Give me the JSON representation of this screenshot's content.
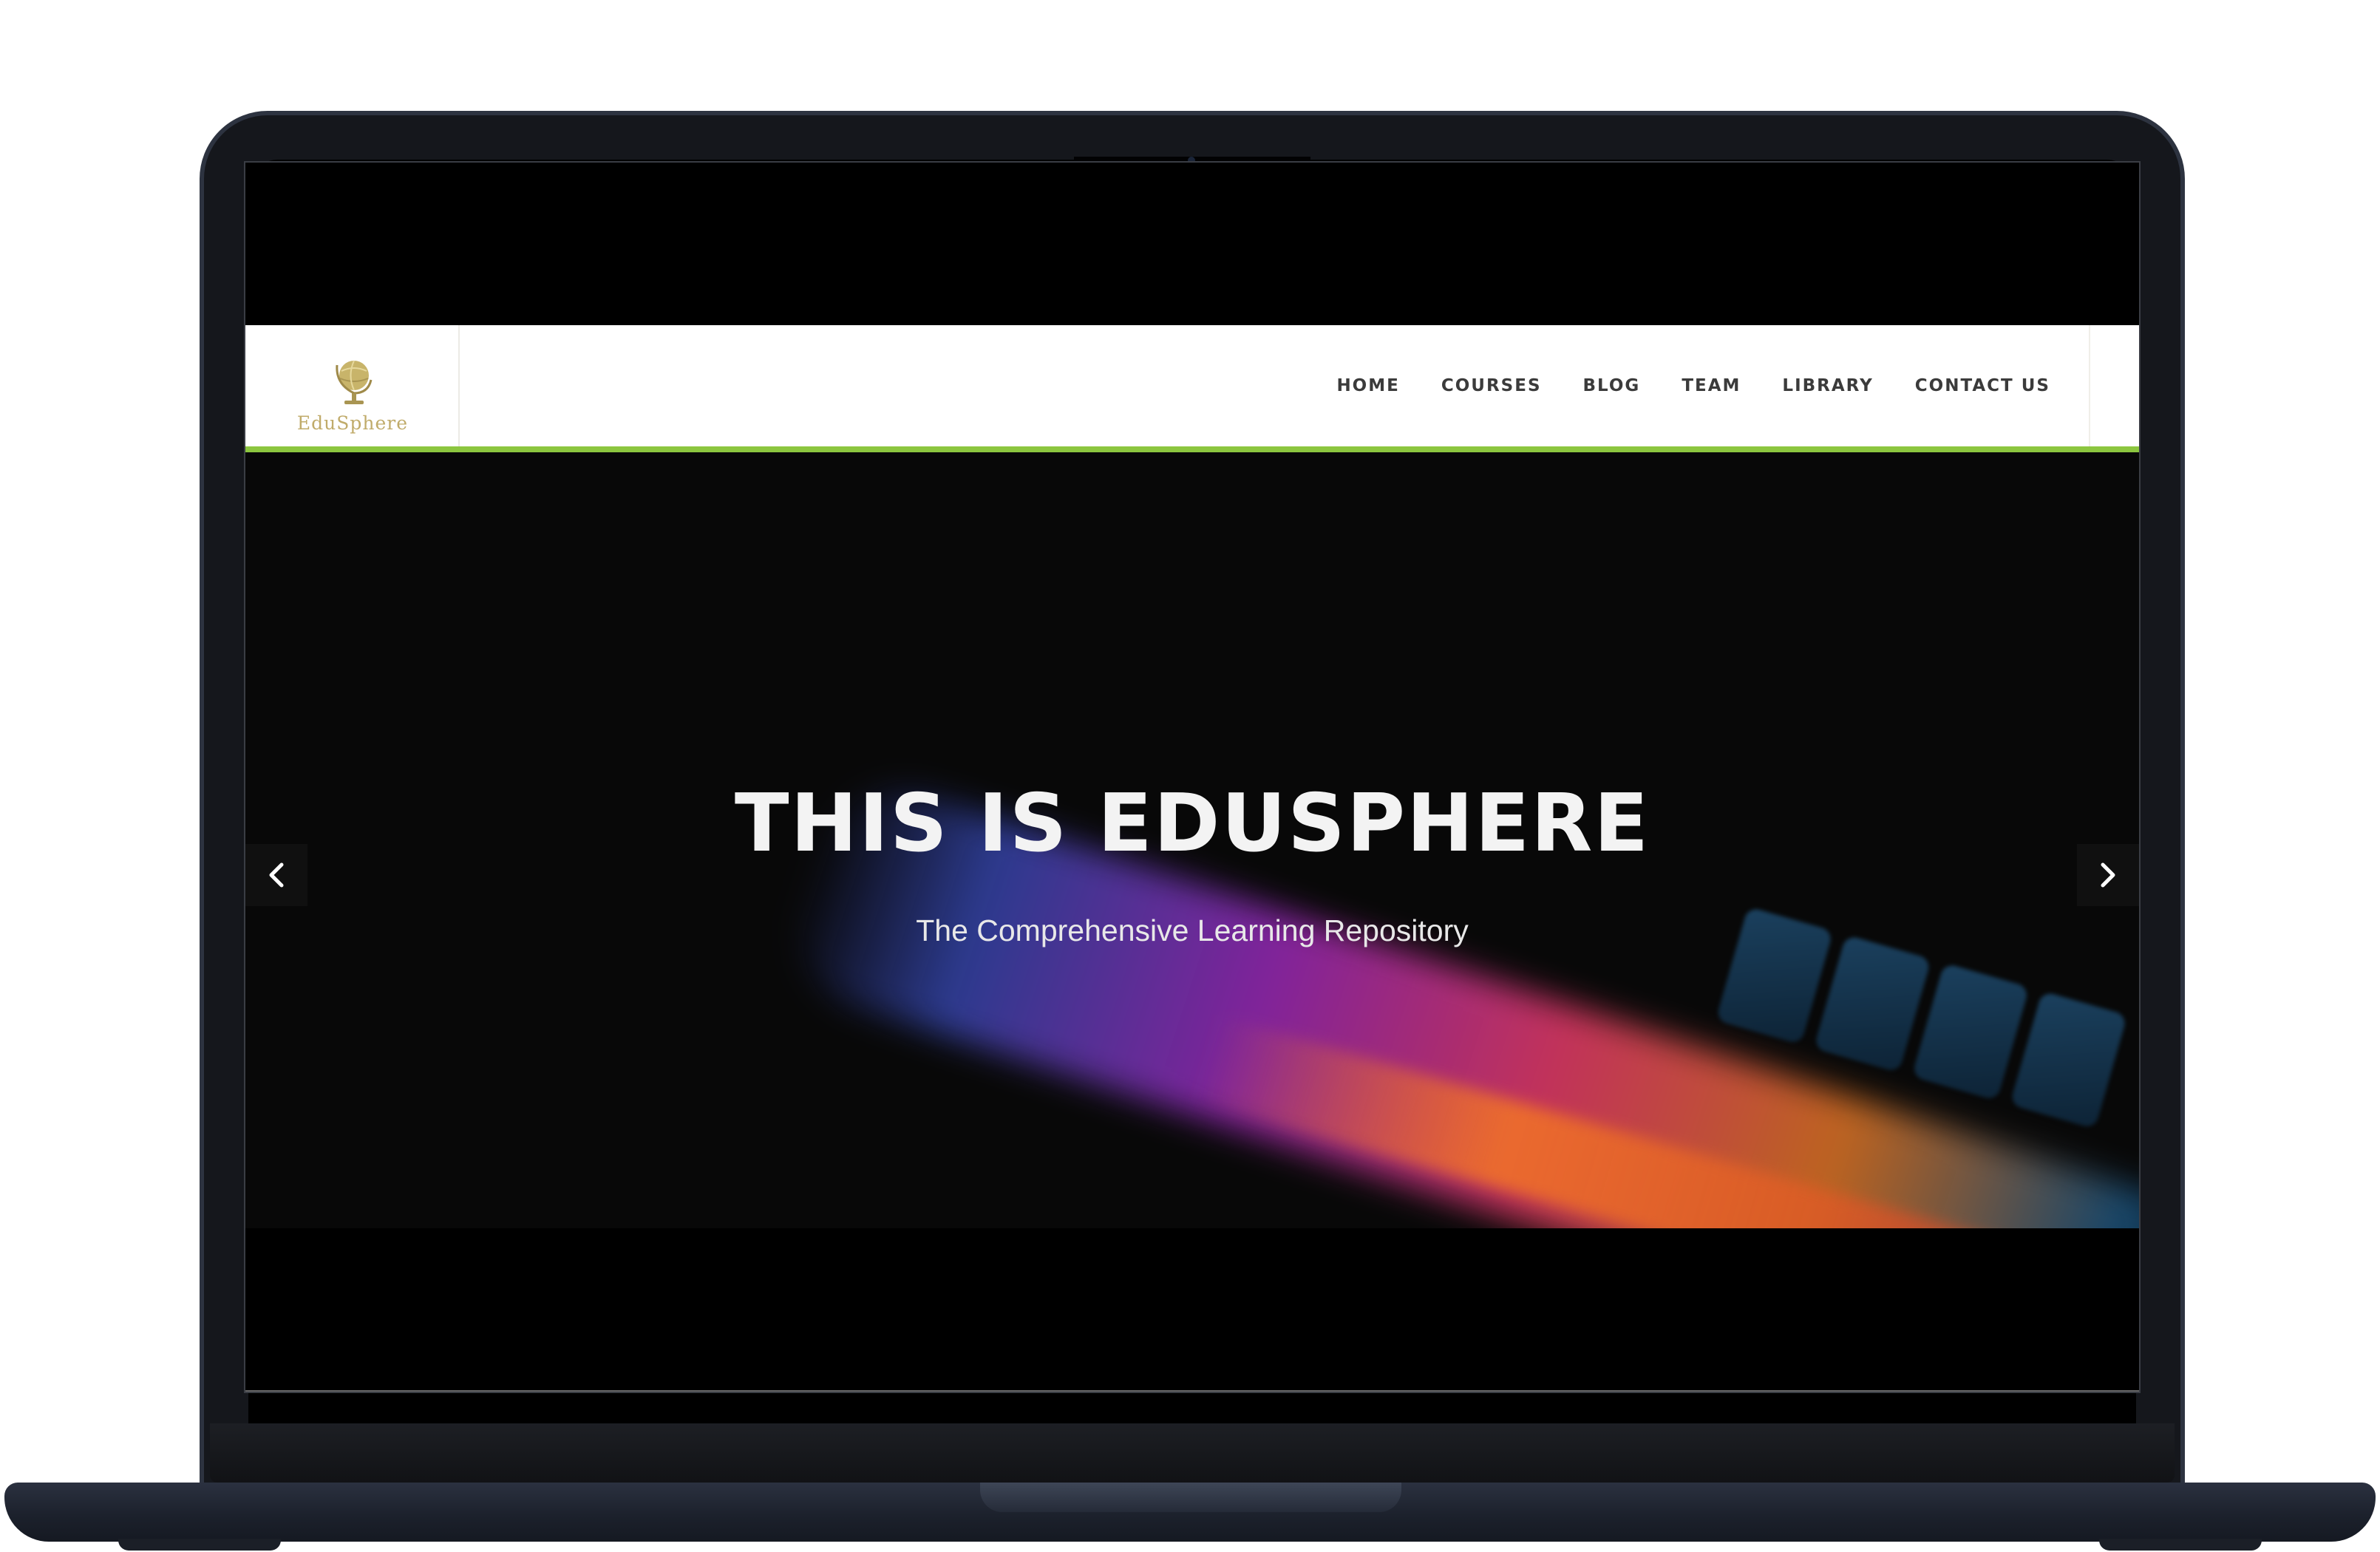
{
  "site": {
    "logo_text": "EduSphere",
    "nav_items": [
      "HOME",
      "COURSES",
      "BLOG",
      "TEAM",
      "LIBRARY",
      "CONTACT US"
    ]
  },
  "hero": {
    "title": "THIS IS EDUSPHERE",
    "subtitle": "The Comprehensive Learning Repository"
  },
  "colors": {
    "accent_bar": "#8cc63f",
    "logo_gold": "#c0ab6a",
    "hero_background": "#080808"
  },
  "icons": {
    "logo": "globe-icon",
    "prev": "chevron-left-icon",
    "next": "chevron-right-icon"
  }
}
